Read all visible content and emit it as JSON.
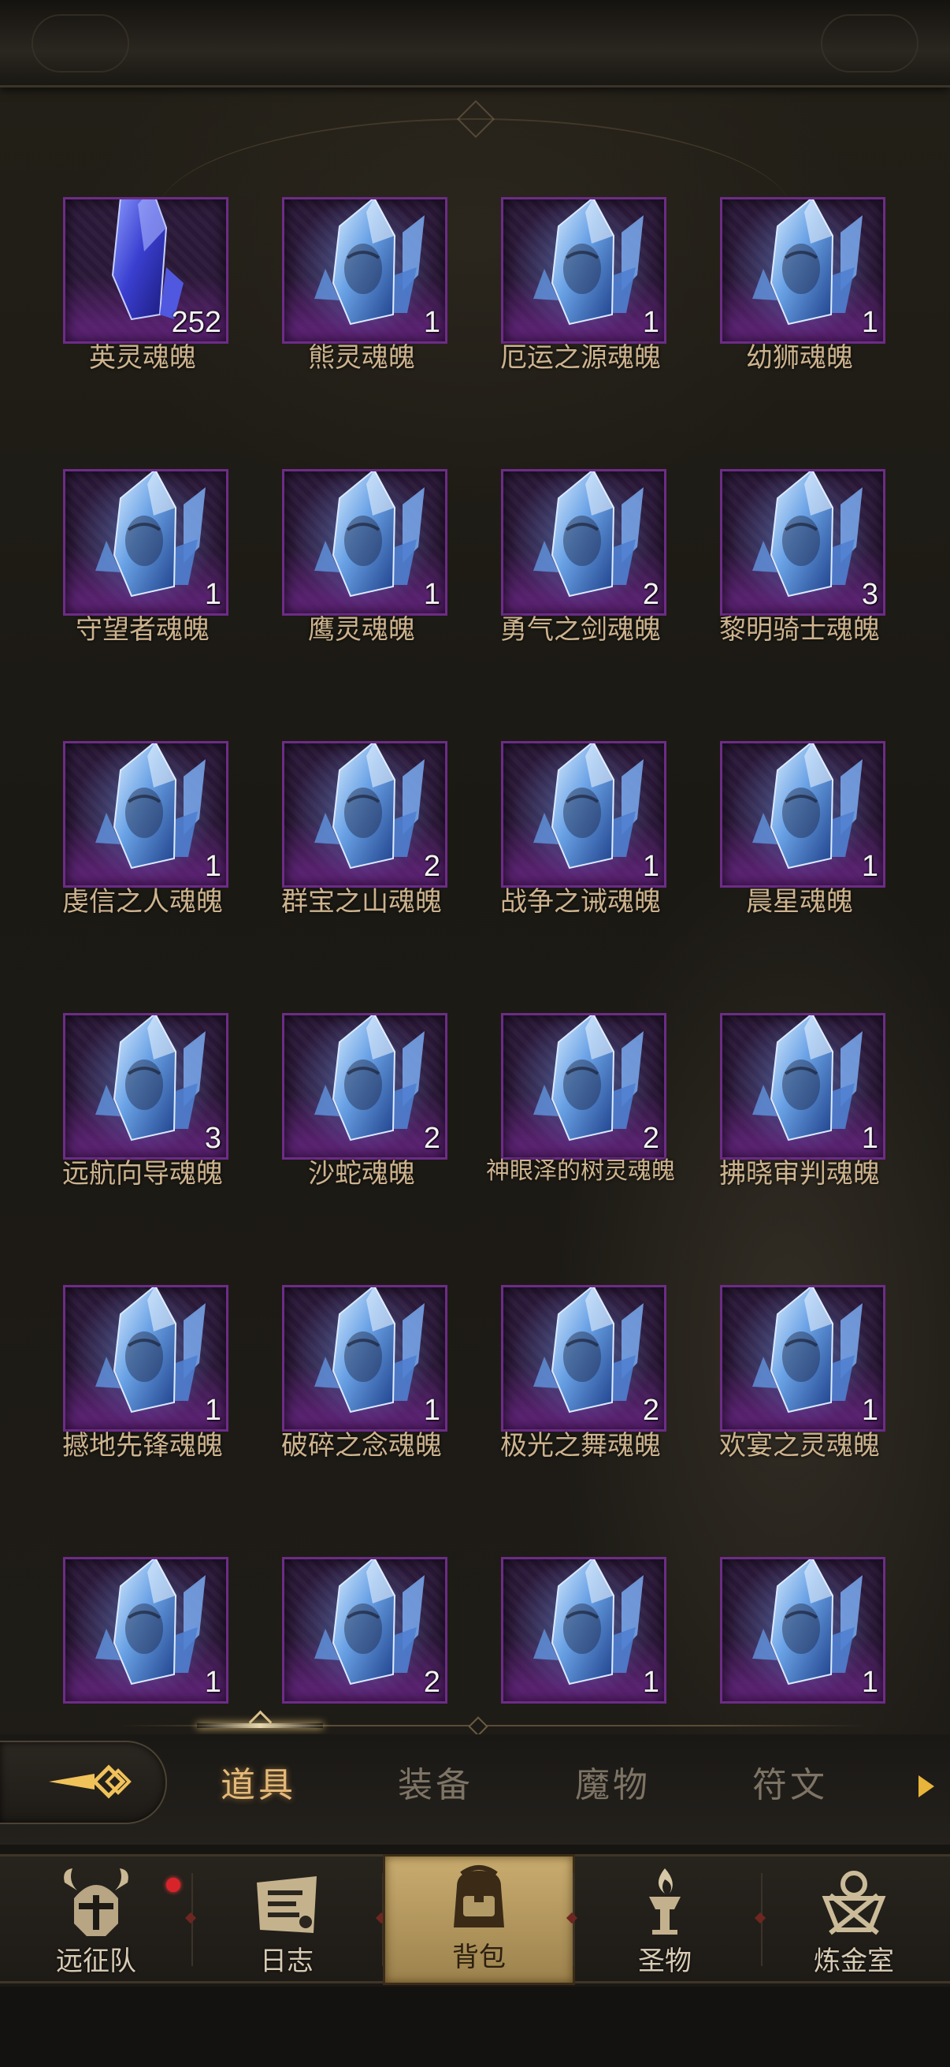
{
  "items": [
    {
      "name": "英灵魂魄",
      "count": "252",
      "kind": "gem"
    },
    {
      "name": "熊灵魂魄",
      "count": "1",
      "kind": "soul"
    },
    {
      "name": "厄运之源魂魄",
      "count": "1",
      "kind": "soul"
    },
    {
      "name": "幼狮魂魄",
      "count": "1",
      "kind": "soul"
    },
    {
      "name": "守望者魂魄",
      "count": "1",
      "kind": "soul"
    },
    {
      "name": "鹰灵魂魄",
      "count": "1",
      "kind": "soul"
    },
    {
      "name": "勇气之剑魂魄",
      "count": "2",
      "kind": "soul"
    },
    {
      "name": "黎明骑士魂魄",
      "count": "3",
      "kind": "soul"
    },
    {
      "name": "虔信之人魂魄",
      "count": "1",
      "kind": "soul"
    },
    {
      "name": "群宝之山魂魄",
      "count": "2",
      "kind": "soul"
    },
    {
      "name": "战争之诫魂魄",
      "count": "1",
      "kind": "soul"
    },
    {
      "name": "晨星魂魄",
      "count": "1",
      "kind": "soul"
    },
    {
      "name": "远航向导魂魄",
      "count": "3",
      "kind": "soul"
    },
    {
      "name": "沙蛇魂魄",
      "count": "2",
      "kind": "soul"
    },
    {
      "name": "神眼泽的树灵魂魄",
      "count": "2",
      "kind": "soul"
    },
    {
      "name": "拂晓审判魂魄",
      "count": "1",
      "kind": "soul"
    },
    {
      "name": "撼地先锋魂魄",
      "count": "1",
      "kind": "soul"
    },
    {
      "name": "破碎之念魂魄",
      "count": "1",
      "kind": "soul"
    },
    {
      "name": "极光之舞魂魄",
      "count": "2",
      "kind": "soul"
    },
    {
      "name": "欢宴之灵魂魄",
      "count": "1",
      "kind": "soul"
    },
    {
      "name": "",
      "count": "1",
      "kind": "soul"
    },
    {
      "name": "",
      "count": "2",
      "kind": "soul"
    },
    {
      "name": "",
      "count": "1",
      "kind": "soul"
    },
    {
      "name": "",
      "count": "1",
      "kind": "soul"
    }
  ],
  "tabs": [
    "道具",
    "装备",
    "魔物",
    "符文"
  ],
  "active_tab": 0,
  "nav": [
    {
      "label": "远征队",
      "icon": "helmet-icon",
      "badge": true
    },
    {
      "label": "日志",
      "icon": "scroll-icon",
      "badge": false
    },
    {
      "label": "背包",
      "icon": "backpack-icon",
      "badge": false
    },
    {
      "label": "圣物",
      "icon": "torch-icon",
      "badge": false
    },
    {
      "label": "炼金室",
      "icon": "alchemy-icon",
      "badge": false
    }
  ],
  "active_nav": 2,
  "colors": {
    "slot_border": "#6d2c87",
    "tab_active": "#e5b979",
    "label": "#cdb38e"
  }
}
